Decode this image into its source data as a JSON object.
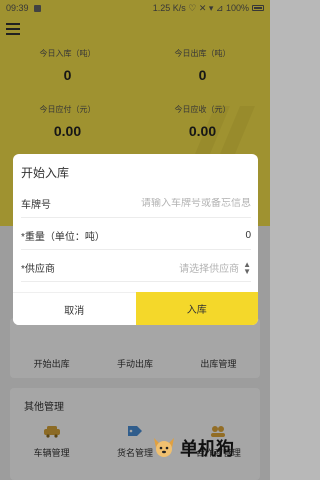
{
  "statusbar": {
    "time": "09:39",
    "right_text": "1.25 K/s ♡ ✕ ▾ ⊿ 100%"
  },
  "stats": {
    "in_today_label": "今日入库（吨）",
    "in_today_value": "0",
    "out_today_label": "今日出库（吨）",
    "out_today_value": "0",
    "pay_today_label": "今日应付（元）",
    "pay_today_value": "0.00",
    "recv_today_label": "今日应收（元）",
    "recv_today_value": "0.00"
  },
  "quick_actions": {
    "start_out": "开始出库",
    "manual_out": "手动出库",
    "out_manage": "出库管理"
  },
  "other_manage": {
    "title": "其他管理",
    "vehicle": "车辆管理",
    "goods": "货名管理",
    "partner": "合作商管理"
  },
  "dialog": {
    "title": "开始入库",
    "plate_label": "车牌号",
    "plate_placeholder": "请输入车牌号或备忘信息",
    "weight_label": "*重量（单位：吨）",
    "weight_value": "0",
    "supplier_label": "*供应商",
    "supplier_placeholder": "请选择供应商",
    "cancel": "取消",
    "confirm": "入库"
  },
  "watermark": {
    "text": "单机狗"
  },
  "colors": {
    "accent": "#f4e04a",
    "button_yellow": "#f4d82a"
  }
}
